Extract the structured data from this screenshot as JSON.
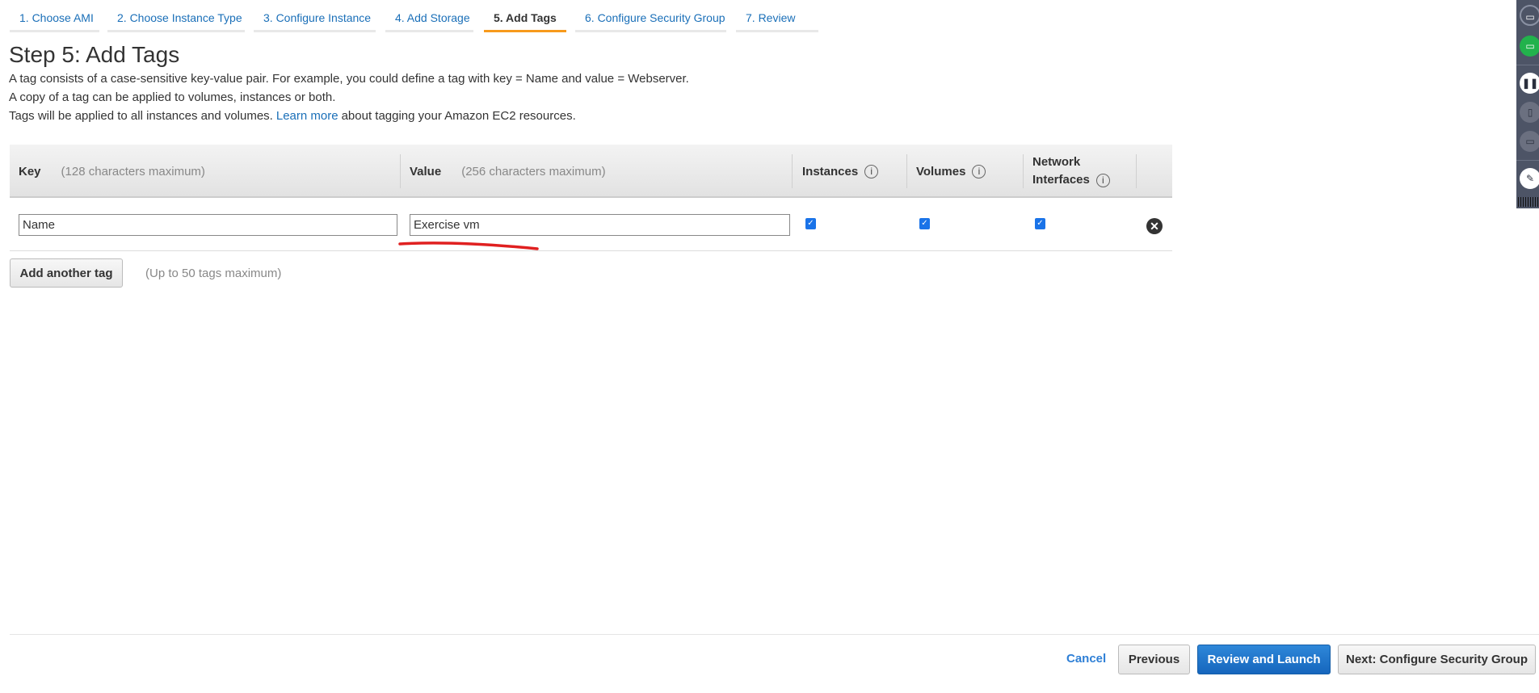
{
  "tabs": [
    {
      "label": "1. Choose AMI",
      "active": false
    },
    {
      "label": "2. Choose Instance Type",
      "active": false
    },
    {
      "label": "3. Configure Instance",
      "active": false
    },
    {
      "label": "4. Add Storage",
      "active": false
    },
    {
      "label": "5. Add Tags",
      "active": true
    },
    {
      "label": "6. Configure Security Group",
      "active": false
    },
    {
      "label": "7. Review",
      "active": false
    }
  ],
  "page": {
    "title": "Step 5: Add Tags",
    "line1": "A tag consists of a case-sensitive key-value pair. For example, you could define a tag with key = Name and value = Webserver.",
    "line2": "A copy of a tag can be applied to volumes, instances or both.",
    "line3_pre": "Tags will be applied to all instances and volumes.",
    "learn_more": "Learn more",
    "line3_post": "about tagging your Amazon EC2 resources."
  },
  "table": {
    "headers": {
      "key": "Key",
      "key_hint": "(128 characters maximum)",
      "value": "Value",
      "value_hint": "(256 characters maximum)",
      "instances": "Instances",
      "volumes": "Volumes",
      "network": "Network",
      "interfaces": "Interfaces"
    },
    "rows": [
      {
        "key": "Name",
        "value": "Exercise vm",
        "instances": true,
        "volumes": true,
        "network_interfaces": true
      }
    ]
  },
  "add_tag": {
    "label": "Add another tag",
    "hint": "(Up to 50 tags maximum)"
  },
  "footer": {
    "cancel": "Cancel",
    "previous": "Previous",
    "review": "Review and Launch",
    "next": "Next: Configure Security Group"
  },
  "colors": {
    "accent": "#f79a1c",
    "link": "#1a6fb8",
    "primary": "#1a6fc4",
    "annotation": "#e02020"
  }
}
